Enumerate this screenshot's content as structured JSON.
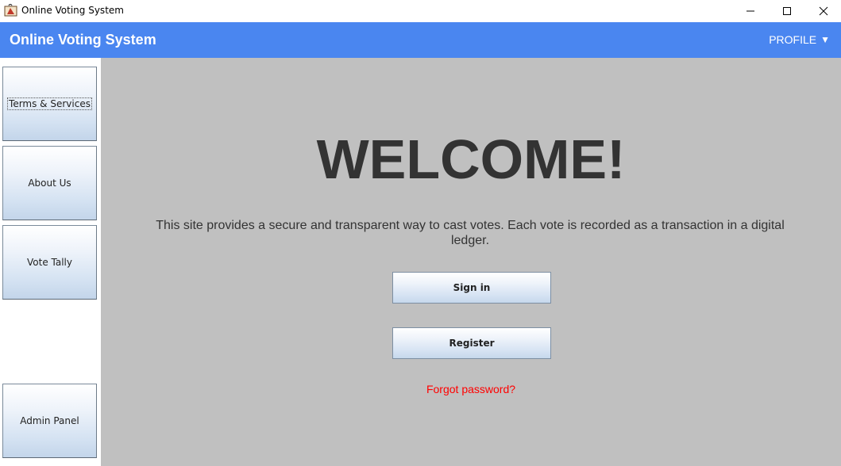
{
  "window": {
    "title": "Online Voting System",
    "controls": [
      "minimize-icon",
      "maximize-icon",
      "close-icon"
    ]
  },
  "header": {
    "title": "Online Voting System",
    "profile_label": "PROFILE",
    "profile_caret": "▼",
    "background_color": "#4a86f0"
  },
  "sidebar": {
    "items": [
      {
        "label": "Terms & Services"
      },
      {
        "label": "About Us"
      },
      {
        "label": "Vote Tally"
      },
      {
        "label": "Admin Panel"
      }
    ]
  },
  "main": {
    "heading": "WELCOME!",
    "intro": "This site provides a secure and transparent way to cast votes. Each vote is recorded as a transaction in a digital ledger.",
    "signin_label": "Sign in",
    "register_label": "Register",
    "forgot_label": "Forgot password?",
    "background_color": "#c0c0c0",
    "link_color": "#ff0000"
  }
}
